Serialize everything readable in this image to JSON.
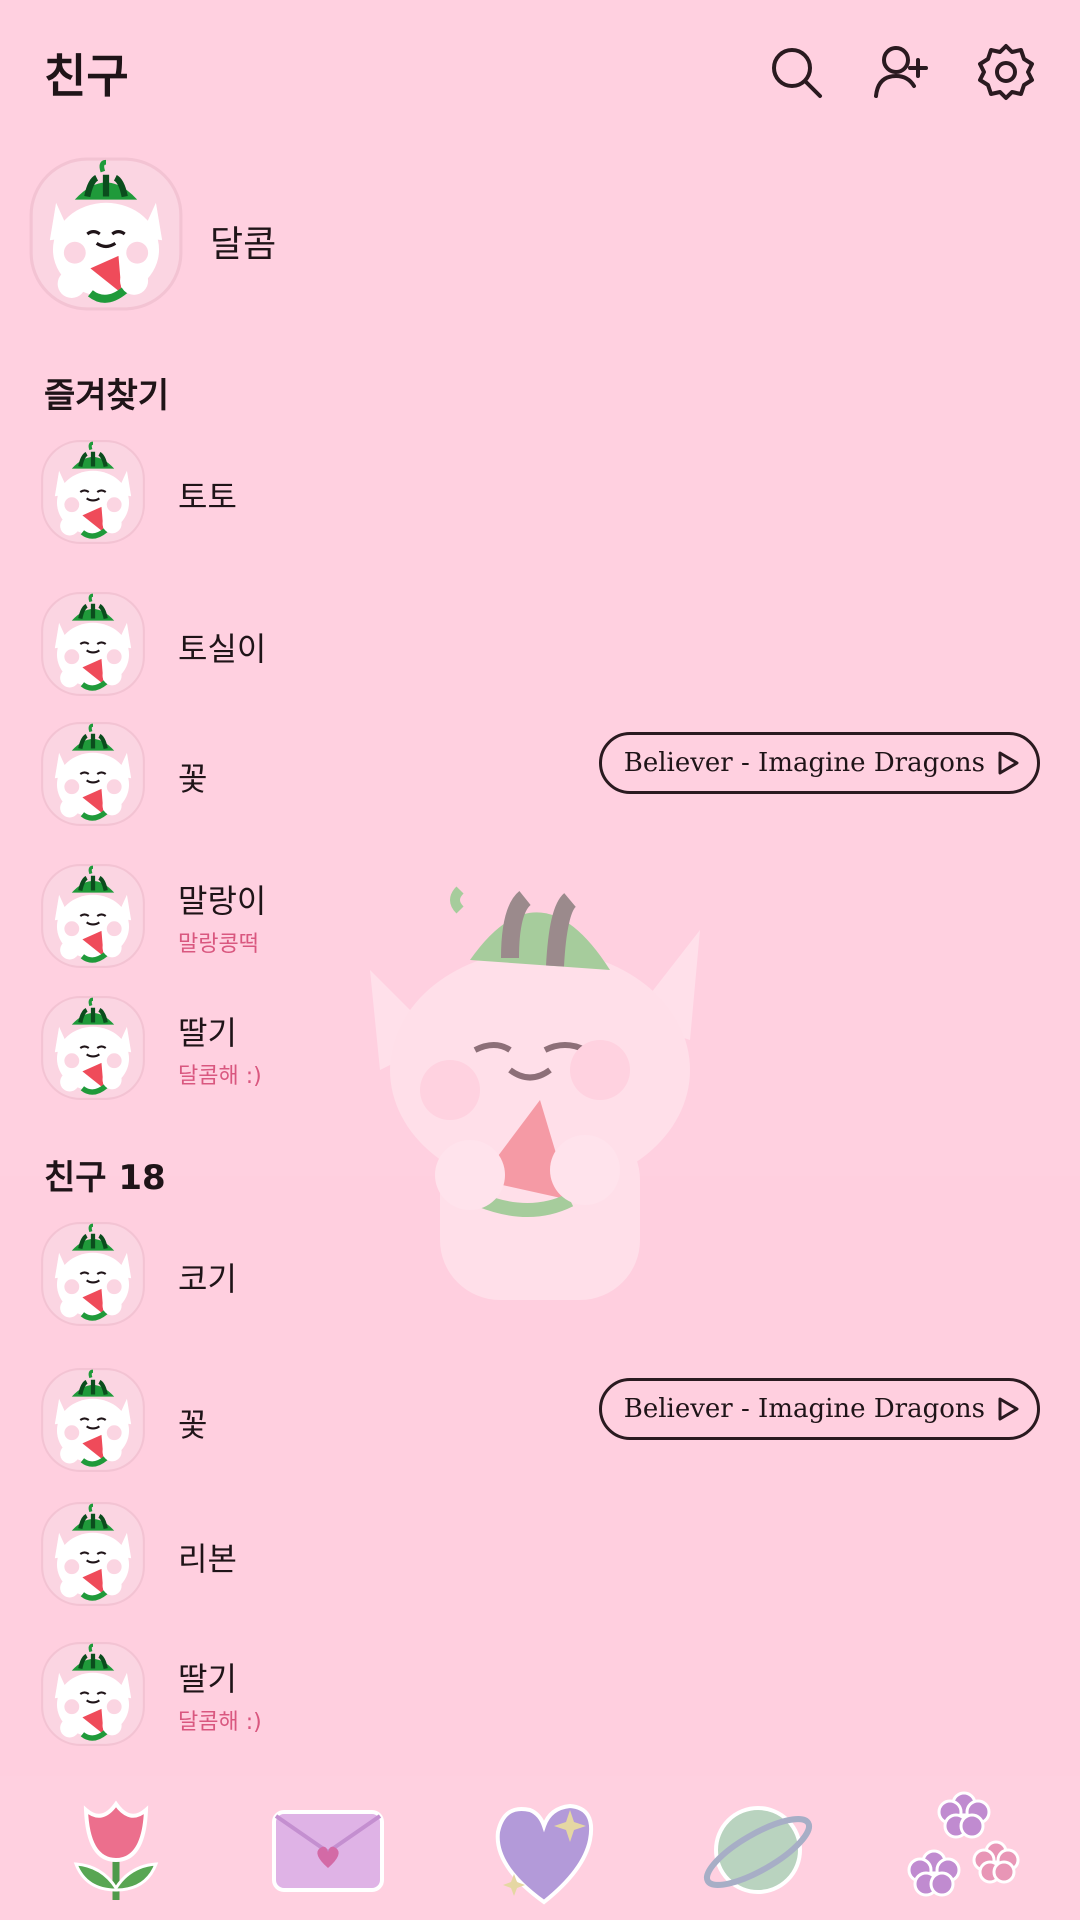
{
  "header": {
    "title": "친구",
    "icons": [
      "search-icon",
      "add-friend-icon",
      "settings-icon"
    ]
  },
  "my_profile": {
    "name": "달콤"
  },
  "favorites": {
    "label": "즐겨찾기",
    "items": [
      {
        "name": "토토"
      },
      {
        "name": "토실이"
      },
      {
        "name": "꽃",
        "music": "Believer - Imagine Dragons"
      },
      {
        "name": "말랑이",
        "status": "말랑콩떡"
      },
      {
        "name": "딸기",
        "status": "달콤해 :)"
      }
    ]
  },
  "friends": {
    "label": "친구 18",
    "items": [
      {
        "name": "코기"
      },
      {
        "name": "꽃",
        "music": "Believer - Imagine Dragons"
      },
      {
        "name": "리본"
      },
      {
        "name": "딸기",
        "status": "달콤해 :)"
      }
    ]
  },
  "bottom_nav": {
    "items": [
      "tulip-icon",
      "envelope-icon",
      "heart-icon",
      "planet-icon",
      "flowers-icon"
    ]
  },
  "colors": {
    "background": "#ffd0e0",
    "status_text": "#d9577f",
    "text": "#1f1418"
  }
}
